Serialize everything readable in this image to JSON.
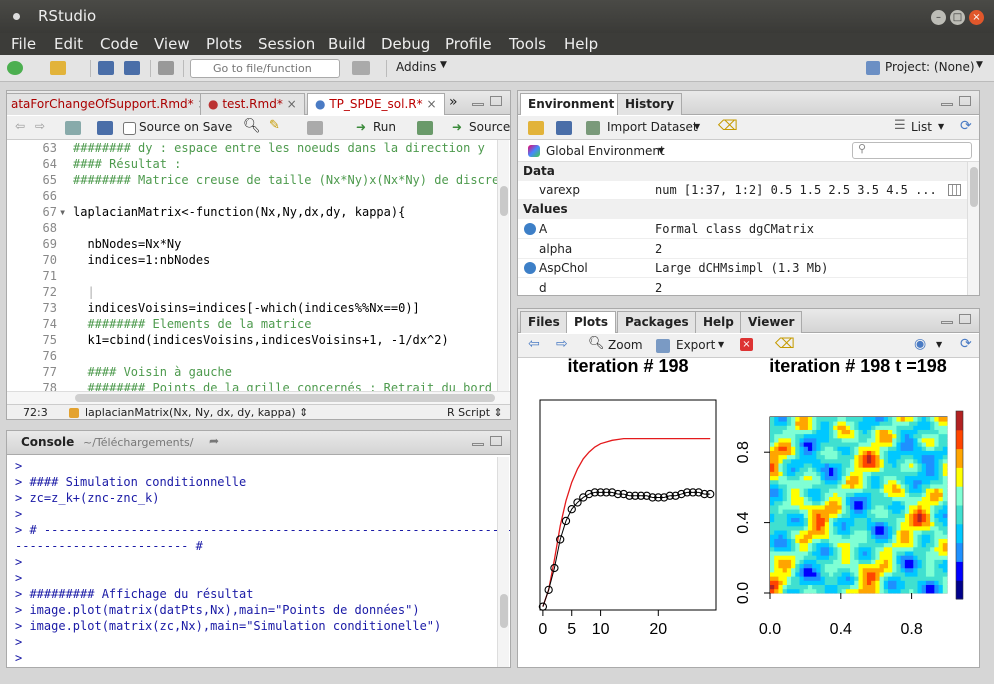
{
  "window": {
    "title": "RStudio"
  },
  "menu": [
    "File",
    "Edit",
    "Code",
    "View",
    "Plots",
    "Session",
    "Build",
    "Debug",
    "Profile",
    "Tools",
    "Help"
  ],
  "toolbar": {
    "goto_placeholder": "Go to file/function",
    "addins": "Addins",
    "project": "Project: (None)"
  },
  "editor": {
    "tabs": [
      "ataForChangeOfSupport.Rmd*",
      "test.Rmd*",
      "TP_SPDE_sol.R*"
    ],
    "source_on_save": "Source on Save",
    "run": "Run",
    "source": "Source",
    "lines": [
      {
        "n": "63",
        "t": "######## dy : espace entre les noeuds dans la direction y"
      },
      {
        "n": "64",
        "t": "#### Résultat :"
      },
      {
        "n": "65",
        "t": "######## Matrice creuse de taille (Nx*Ny)x(Nx*Ny) de discretis"
      },
      {
        "n": "66",
        "t": ""
      },
      {
        "n": "67",
        "t": "laplacianMatrix<-function(Nx,Ny,dx,dy, kappa){"
      },
      {
        "n": "68",
        "t": ""
      },
      {
        "n": "69",
        "t": "  nbNodes=Nx*Ny"
      },
      {
        "n": "70",
        "t": "  indices=1:nbNodes"
      },
      {
        "n": "71",
        "t": ""
      },
      {
        "n": "72",
        "t": "  |"
      },
      {
        "n": "73",
        "t": "  indicesVoisins=indices[-which(indices%%Nx==0)]"
      },
      {
        "n": "74",
        "t": "  ######## Elements de la matrice"
      },
      {
        "n": "75",
        "t": "  k1=cbind(indicesVoisins,indicesVoisins+1, -1/dx^2)"
      },
      {
        "n": "76",
        "t": ""
      },
      {
        "n": "77",
        "t": "  #### Voisin à gauche"
      },
      {
        "n": "78",
        "t": "  ######## Points de la grille concernés : Retrait du bord gau"
      }
    ],
    "status_pos": "72:3",
    "status_fn": "laplacianMatrix(Nx, Ny, dx, dy, kappa) ⇕",
    "status_type": "R Script ⇕"
  },
  "console": {
    "title": "Console",
    "path": "~/Téléchargements/",
    "lines": [
      ">",
      "> #### Simulation conditionnelle",
      "> zc=z_k+(znc-znc_k)",
      ">",
      "> # -------------------------------------------------------------------",
      "------------------------ #",
      ">",
      ">",
      "> ######### Affichage du résultat",
      "> image.plot(matrix(datPts,Nx),main=\"Points de données\")",
      "> image.plot(matrix(zc,Nx),main=\"Simulation conditionelle\")",
      ">",
      ">"
    ]
  },
  "environment": {
    "tabs": [
      "Environment",
      "History"
    ],
    "import": "Import Dataset",
    "list": "List",
    "global": "Global Environment",
    "sections": {
      "data": "Data",
      "values": "Values"
    },
    "data_rows": [
      {
        "name": "varexp",
        "value": "num [1:37, 1:2] 0.5 1.5 2.5 3.5 4.5 ..."
      }
    ],
    "value_rows": [
      {
        "name": "A",
        "value": "Formal class dgCMatrix",
        "icon": true
      },
      {
        "name": "alpha",
        "value": "2",
        "icon": false
      },
      {
        "name": "AspChol",
        "value": "Large dCHMsimpl (1.3 Mb)",
        "icon": true
      },
      {
        "name": "d",
        "value": "2",
        "icon": false
      }
    ]
  },
  "files": {
    "tabs": [
      "Files",
      "Plots",
      "Packages",
      "Help",
      "Viewer"
    ],
    "zoom": "Zoom",
    "export": "Export"
  },
  "chart_data": [
    {
      "type": "line",
      "title": "iteration # 198",
      "x_ticks": [
        "0",
        "5",
        "10",
        "20"
      ],
      "x_tick_values": [
        0,
        5,
        10,
        20
      ],
      "xlim": [
        -0.5,
        30
      ],
      "ylim": [
        0,
        1.25
      ],
      "series": [
        {
          "type": "line",
          "color": "#e41a1c",
          "x": [
            0,
            1,
            2,
            3,
            4,
            5,
            6,
            7,
            8,
            9,
            10,
            12,
            14,
            16,
            18,
            20,
            22,
            24,
            26,
            28,
            29
          ],
          "y": [
            0.02,
            0.12,
            0.3,
            0.5,
            0.65,
            0.76,
            0.84,
            0.9,
            0.94,
            0.97,
            0.99,
            1.01,
            1.02,
            1.02,
            1.02,
            1.02,
            1.02,
            1.02,
            1.02,
            1.02,
            1.02
          ]
        },
        {
          "type": "scatter",
          "color": "#000000",
          "x": [
            0,
            1,
            2,
            3,
            4,
            5,
            6,
            7,
            8,
            9,
            10,
            11,
            12,
            13,
            14,
            15,
            16,
            17,
            18,
            19,
            20,
            21,
            22,
            23,
            24,
            25,
            26,
            27,
            28,
            29
          ],
          "y": [
            0.02,
            0.12,
            0.25,
            0.42,
            0.53,
            0.6,
            0.64,
            0.67,
            0.69,
            0.7,
            0.7,
            0.7,
            0.7,
            0.69,
            0.69,
            0.68,
            0.68,
            0.68,
            0.68,
            0.67,
            0.67,
            0.67,
            0.68,
            0.68,
            0.69,
            0.7,
            0.7,
            0.7,
            0.69,
            0.69
          ]
        }
      ]
    },
    {
      "type": "heatmap",
      "title": "iteration # 198 t =198",
      "x_ticks": [
        "0.0",
        "0.4",
        "0.8"
      ],
      "y_ticks": [
        "0.0",
        "0.4",
        "0.8"
      ],
      "tick_values": [
        0,
        0.4,
        0.8
      ],
      "xlim": [
        0,
        1
      ],
      "ylim": [
        0,
        1
      ],
      "colorscale": [
        "#00008b",
        "#0000ff",
        "#1e90ff",
        "#00c8ff",
        "#40e0d0",
        "#7fffd4",
        "#ffff00",
        "#ffa500",
        "#ff4500",
        "#b22222"
      ]
    }
  ]
}
